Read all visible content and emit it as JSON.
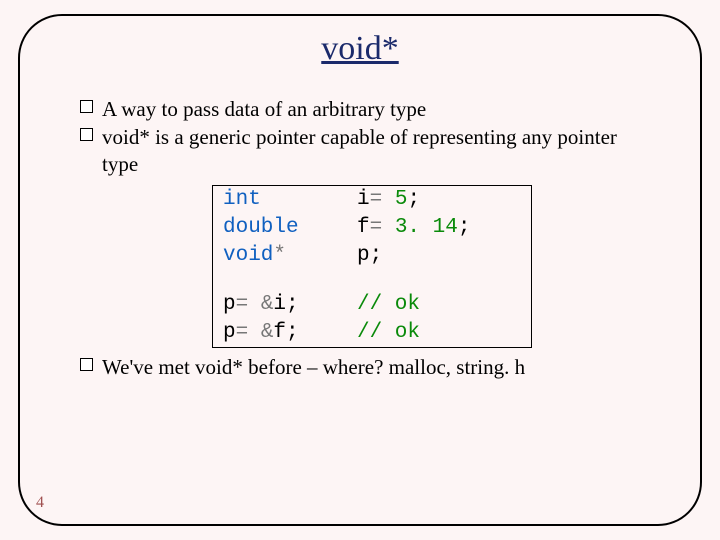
{
  "title": "void*",
  "bullets": {
    "b1": "A way to pass data of an arbitrary type",
    "b2": "void* is a generic pointer capable of representing any pointer type",
    "b3": "We've met void* before – where? malloc, string. h"
  },
  "code": {
    "r1c1_kw": "int",
    "r1c2_a": "i",
    "r1c2_op": "= ",
    "r1c2_b": "5",
    "r1c2_end": ";",
    "r2c1_kw": "double",
    "r2c2_a": "f",
    "r2c2_op": "= ",
    "r2c2_b": "3. 14",
    "r2c2_end": ";",
    "r3c1_kw": "void",
    "r3c1_star": "*",
    "r3c2": "p;",
    "r4c1_a": "p",
    "r4c1_op": "= &",
    "r4c1_b": "i;",
    "r4c2": "// ok",
    "r5c1_a": "p",
    "r5c1_op": "= &",
    "r5c1_b": "f;",
    "r5c2": "// ok"
  },
  "page": "4"
}
